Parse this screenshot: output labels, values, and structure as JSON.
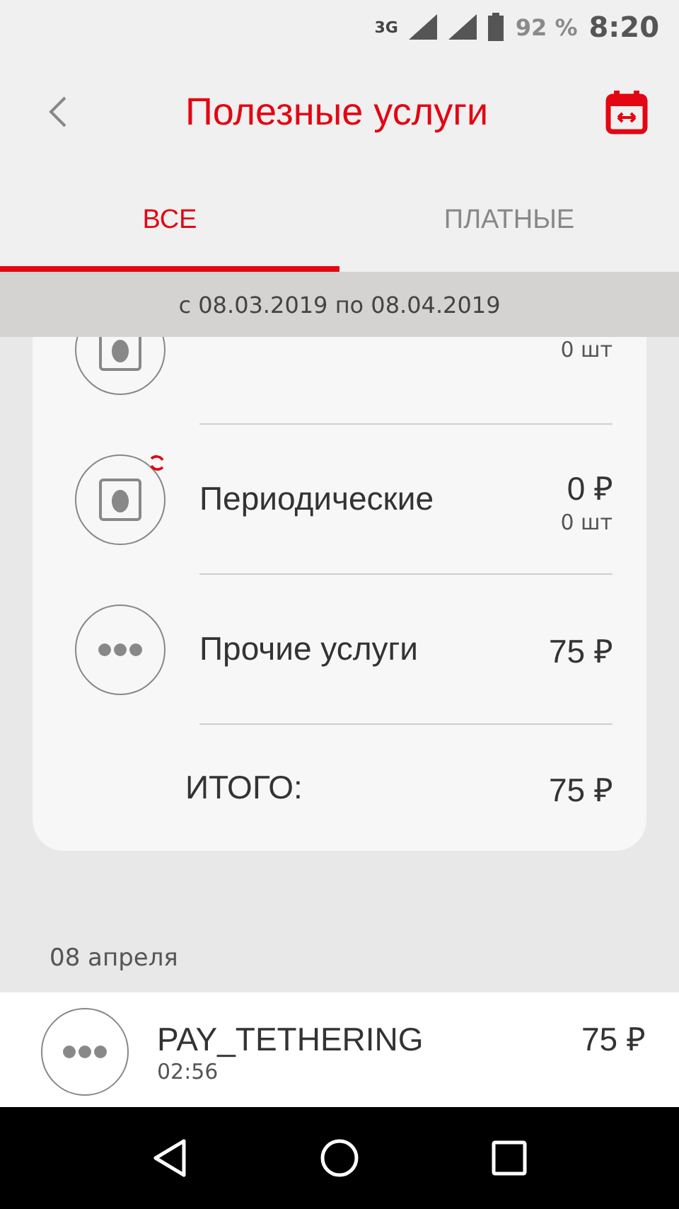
{
  "status_bar": {
    "network": "3G",
    "battery": "92 %",
    "time": "8:20"
  },
  "header": {
    "title": "Полезные услуги"
  },
  "tabs": [
    {
      "label": "ВСЕ",
      "selected": true
    },
    {
      "label": "ПЛАТНЫЕ",
      "selected": false
    }
  ],
  "period": "с 08.03.2019 по 08.04.2019",
  "categories": [
    {
      "kind": "once",
      "count": "0 шт"
    },
    {
      "kind": "periodic",
      "name": "Периодические",
      "amount": "0 ₽",
      "count": "0 шт"
    },
    {
      "kind": "other",
      "name": "Прочие услуги",
      "amount": "75 ₽"
    }
  ],
  "total": {
    "label": "ИТОГО:",
    "amount": "75 ₽"
  },
  "date_group": "08 апреля",
  "transactions": [
    {
      "name": "PAY_TETHERING",
      "time": "02:56",
      "amount": "75 ₽"
    }
  ]
}
